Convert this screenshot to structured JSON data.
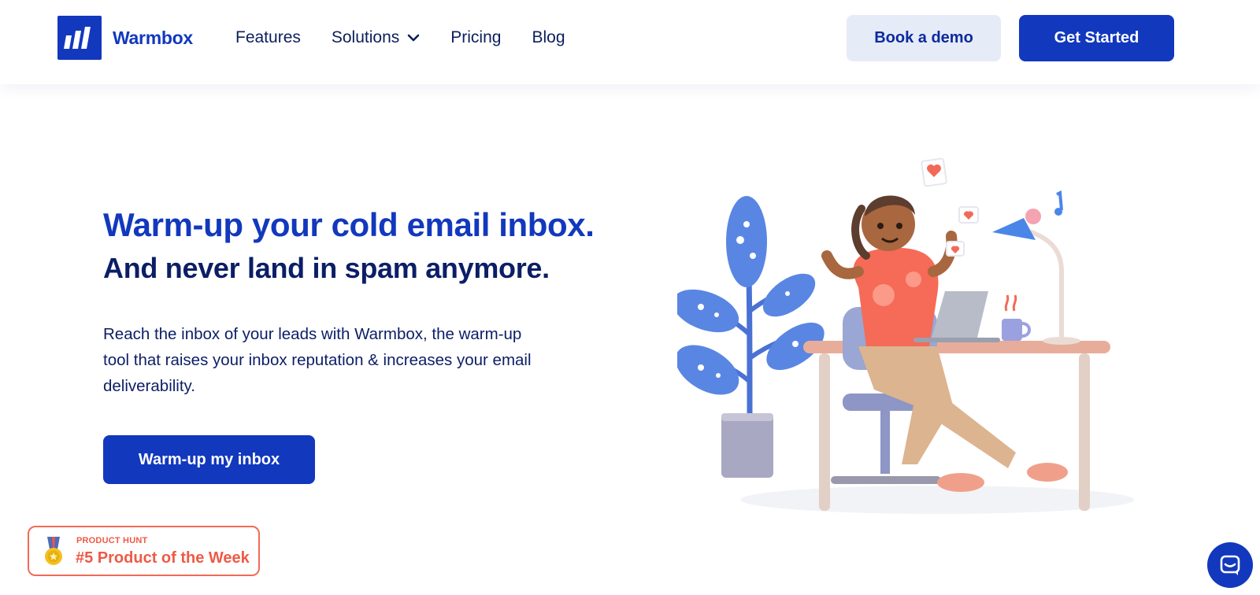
{
  "header": {
    "brand": "Warmbox",
    "nav": [
      {
        "label": "Features"
      },
      {
        "label": "Solutions",
        "has_dropdown": true
      },
      {
        "label": "Pricing"
      },
      {
        "label": "Blog"
      }
    ],
    "book_demo": "Book a demo",
    "get_started": "Get Started"
  },
  "hero": {
    "title": "Warm-up your cold email inbox.",
    "subtitle": "And never land in spam anymore.",
    "description": "Reach the inbox of your leads with Warmbox, the warm-up tool that raises your inbox reputation & increases your email deliverability.",
    "cta": "Warm-up my inbox"
  },
  "product_hunt": {
    "label": "PRODUCT HUNT",
    "title": "#5 Product of the Week",
    "icon": "medal-icon"
  },
  "chat": {
    "icon": "chat-icon"
  },
  "colors": {
    "brand": "#1238bd",
    "navy": "#0b1e66",
    "demo_bg": "#e6ebf8",
    "product_hunt": "#ee5a45"
  }
}
